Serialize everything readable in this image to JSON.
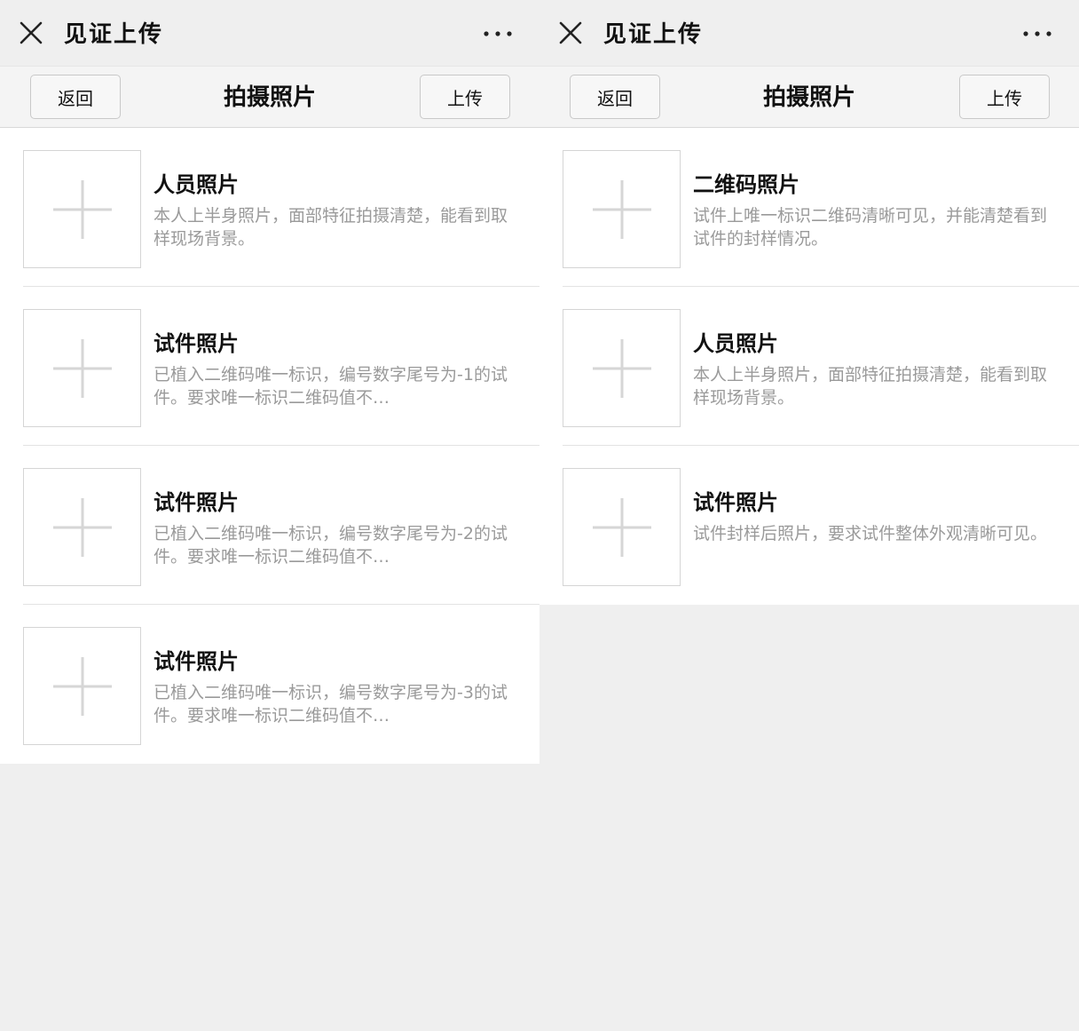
{
  "screens": [
    {
      "app_title": "见证上传",
      "nav": {
        "back_label": "返回",
        "title": "拍摄照片",
        "upload_label": "上传"
      },
      "items": [
        {
          "title": "人员照片",
          "desc": "本人上半身照片，面部特征拍摄清楚，能看到取样现场背景。"
        },
        {
          "title": "试件照片",
          "desc": "已植入二维码唯一标识，编号数字尾号为-1的试件。要求唯一标识二维码值不…"
        },
        {
          "title": "试件照片",
          "desc": "已植入二维码唯一标识，编号数字尾号为-2的试件。要求唯一标识二维码值不…"
        },
        {
          "title": "试件照片",
          "desc": "已植入二维码唯一标识，编号数字尾号为-3的试件。要求唯一标识二维码值不…"
        }
      ]
    },
    {
      "app_title": "见证上传",
      "nav": {
        "back_label": "返回",
        "title": "拍摄照片",
        "upload_label": "上传"
      },
      "items": [
        {
          "title": "二维码照片",
          "desc": "试件上唯一标识二维码清晰可见，并能清楚看到试件的封样情况。"
        },
        {
          "title": "人员照片",
          "desc": "本人上半身照片，面部特征拍摄清楚，能看到取样现场背景。"
        },
        {
          "title": "试件照片",
          "desc": "试件封样后照片，要求试件整体外观清晰可见。"
        }
      ]
    }
  ],
  "icons": {
    "close": "close-icon",
    "more": "more-icon",
    "add_photo": "plus-icon"
  },
  "colors": {
    "page_bg": "#efefef",
    "list_bg": "#ffffff",
    "title_text": "#111111",
    "desc_text": "#9a9a9a",
    "plus_stroke": "#d6d6d6"
  }
}
